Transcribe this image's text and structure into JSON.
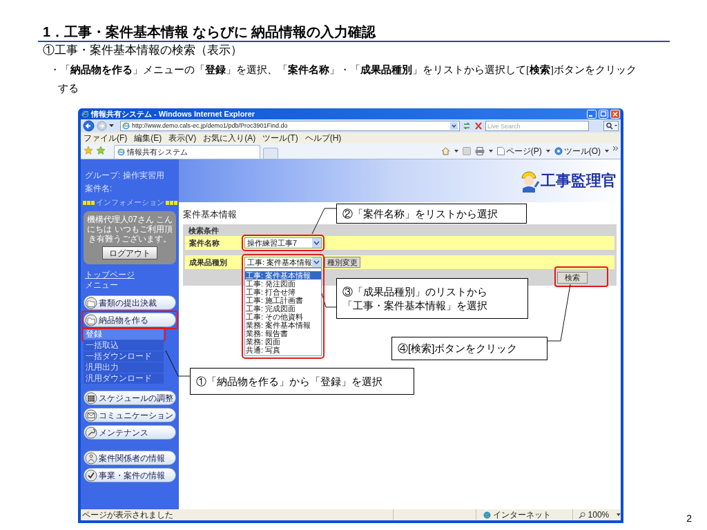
{
  "slide_title": "1．工事・案件基本情報 ならびに 納品情報の入力確認",
  "section_title": "①工事・案件基本情報の検索（表示）",
  "instruction": "・「**納品物を作る**」メニューの「**登録**」を選択、「**案件名称**」・「**成果品種別**」をリストから選択して[**検索**]ボタンをクリックする",
  "browser": {
    "title": "情報共有システム - Windows Internet Explorer",
    "address": "http://www.demo.cals-ec.jp/demo1/pdb/Proc3901Find.do",
    "search_placeholder": "Live Search",
    "menu": [
      "ファイル(F)",
      "編集(E)",
      "表示(V)",
      "お気に入り(A)",
      "ツール(T)",
      "ヘルプ(H)"
    ],
    "tab": "情報共有システム",
    "tools": [
      "ページ(P)",
      "ツール(O)"
    ],
    "status": "ページが表示されました",
    "zone": "インターネット",
    "zoom": "100%",
    "app": {
      "group": "グループ: 操作実習用",
      "project": "案件名:",
      "info_title": "インフォメーション",
      "welcome": "機構代理人07さん こんにちは いつもご利用頂き有難うございます。",
      "logout": "ログアウト",
      "top_link": "トップページ",
      "menu_title": "メニュー",
      "menu_groups": [
        [
          {
            "label": "書類の提出決裁",
            "kind": "folder",
            "highlighted": false
          },
          {
            "label": "納品物を作る",
            "kind": "folder",
            "highlighted": true,
            "children": [
              {
                "label": "登録",
                "selected": true,
                "highlighted": true
              },
              {
                "label": "一括取込",
                "selected": false,
                "highlighted": false
              },
              {
                "label": "一括ダウンロード",
                "selected": false,
                "highlighted": false
              },
              {
                "label": "汎用出力",
                "selected": false,
                "highlighted": false
              },
              {
                "label": "汎用ダウンロード",
                "selected": false,
                "highlighted": false
              }
            ]
          }
        ],
        [
          {
            "label": "スケジュールの調整",
            "kind": "calendar",
            "highlighted": false
          },
          {
            "label": "コミュニケーション",
            "kind": "mail",
            "highlighted": false
          },
          {
            "label": "メンテナンス",
            "kind": "wrench",
            "highlighted": false
          }
        ],
        [
          {
            "label": "案件関係者の情報",
            "kind": "people",
            "highlighted": false
          },
          {
            "label": "事業・案件の情報",
            "kind": "check",
            "highlighted": false
          }
        ]
      ],
      "logo": "工事監理官",
      "heading": "案件基本情報",
      "conditions_title": "検索条件",
      "fields": [
        {
          "label": "案件名称",
          "value": "操作練習工事7",
          "highlighted": true,
          "expanded": false
        },
        {
          "label": "成果品種別",
          "value": "工事: 案件基本情報",
          "button": "種別変更",
          "highlighted": true,
          "expanded": true,
          "options": [
            {
              "label": "工事: 案件基本情報",
              "selected": true
            },
            {
              "label": "工事: 発注図面",
              "selected": false
            },
            {
              "label": "工事: 打合せ簿",
              "selected": false
            },
            {
              "label": "工事: 施工計画書",
              "selected": false
            },
            {
              "label": "工事: 完成図面",
              "selected": false
            },
            {
              "label": "工事: その他資料",
              "selected": false
            },
            {
              "label": "業務: 案件基本情報",
              "selected": false
            },
            {
              "label": "業務: 報告書",
              "selected": false
            },
            {
              "label": "業務: 図面",
              "selected": false
            },
            {
              "label": "共通: 写真",
              "selected": false
            }
          ]
        }
      ],
      "search_button": {
        "label": "検索",
        "highlighted": true
      }
    }
  },
  "callouts": [
    {
      "lines": [
        "②「案件名称」をリストから選択"
      ]
    },
    {
      "lines": [
        "③「成果品種別」のリストから",
        "「工事・案件基本情報」を選択"
      ]
    },
    {
      "lines": [
        "④[検索]ボタンをクリック"
      ]
    },
    {
      "lines": [
        "①「納品物を作る」から「登録」を選択"
      ]
    }
  ],
  "page_number": "2"
}
